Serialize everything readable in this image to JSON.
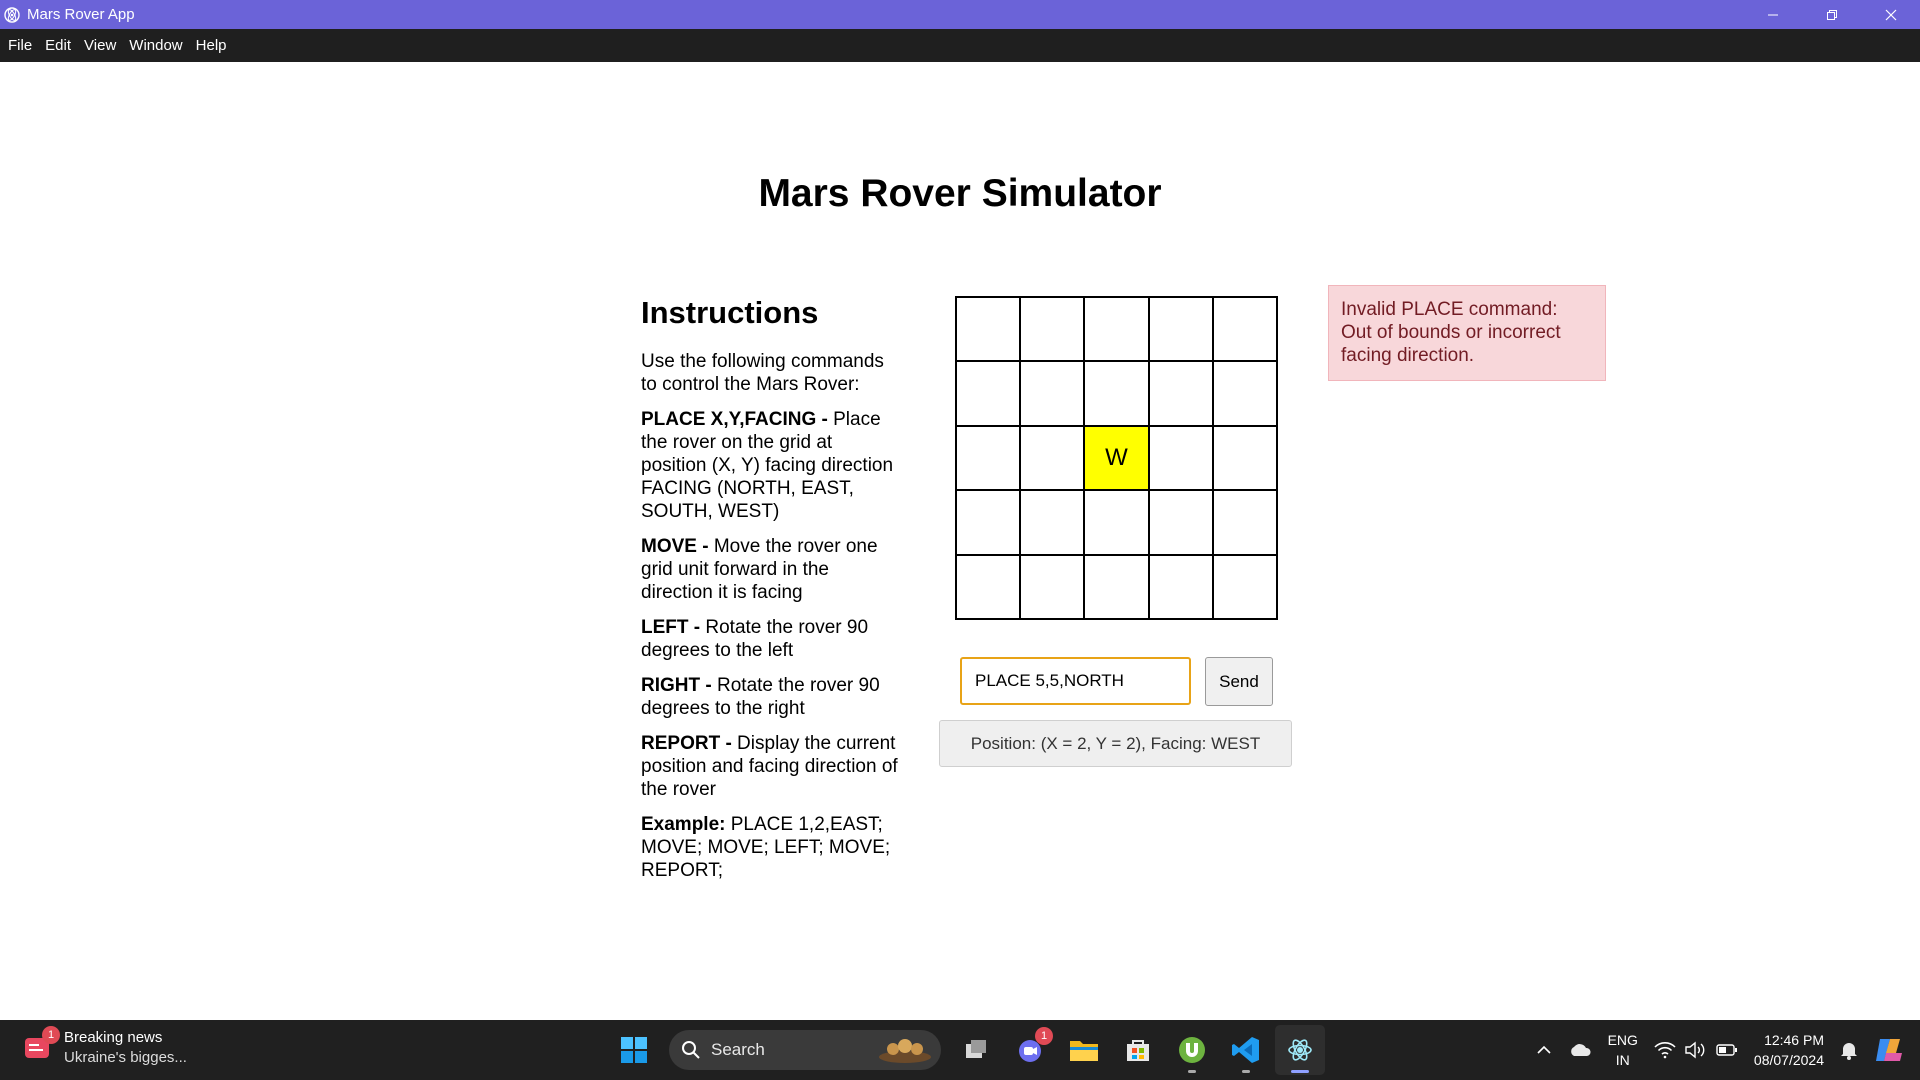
{
  "window": {
    "title": "Mars Rover App"
  },
  "menu": [
    "File",
    "Edit",
    "View",
    "Window",
    "Help"
  ],
  "page": {
    "title": "Mars Rover Simulator"
  },
  "instructions": {
    "heading": "Instructions",
    "intro": "Use the following commands to control the Mars Rover:",
    "commands": [
      {
        "name": "PLACE X,Y,FACING -",
        "desc": " Place the rover on the grid at position (X, Y) facing direction FACING (NORTH, EAST, SOUTH, WEST)"
      },
      {
        "name": "MOVE -",
        "desc": " Move the rover one grid unit forward in the direction it is facing"
      },
      {
        "name": "LEFT -",
        "desc": " Rotate the rover 90 degrees to the left"
      },
      {
        "name": "RIGHT -",
        "desc": " Rotate the rover 90 degrees to the right"
      },
      {
        "name": "REPORT -",
        "desc": " Display the current position and facing direction of the rover"
      },
      {
        "name": "Example:",
        "desc": " PLACE 1,2,EAST; MOVE; MOVE; LEFT; MOVE; REPORT;"
      }
    ]
  },
  "grid": {
    "rows": 5,
    "cols": 5,
    "rover": {
      "row": 2,
      "col": 2,
      "label": "W"
    }
  },
  "command": {
    "value": "PLACE 5,5,NORTH",
    "send_label": "Send"
  },
  "report": {
    "text": "Position: (X = 2, Y = 2), Facing: WEST"
  },
  "alert": {
    "text": "Invalid PLACE command: Out of bounds or incorrect facing direction.",
    "bg": "#f8d7da",
    "color": "#721c24"
  },
  "taskbar": {
    "news": {
      "title": "Breaking news",
      "subtitle": "Ukraine's bigges...",
      "badge": "1"
    },
    "search_label": "Search",
    "teams_badge": "1",
    "lang": {
      "line1": "ENG",
      "line2": "IN"
    },
    "clock": {
      "time": "12:46 PM",
      "date": "08/07/2024"
    }
  },
  "colors": {
    "titlebar": "#6b63d8",
    "rover_cell": "#ffff00",
    "input_border": "#e8a317"
  }
}
